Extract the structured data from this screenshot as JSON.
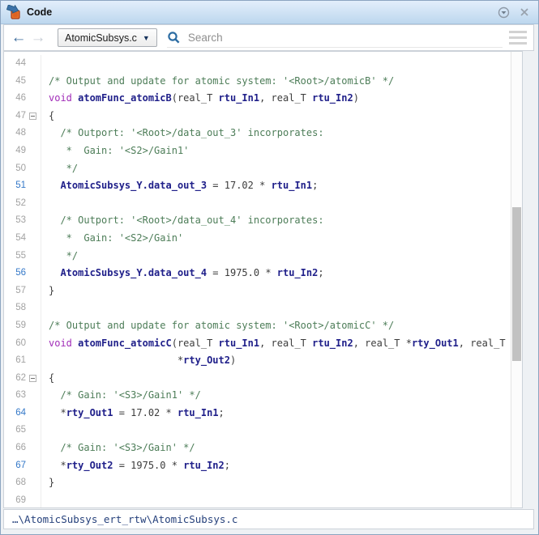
{
  "window": {
    "title": "Code"
  },
  "titlebar": {
    "app_icon": "simulink-code-badge-icon",
    "pin_icon": "dock-menu-icon",
    "close_icon": "close-icon"
  },
  "toolbar": {
    "back_arrow": "←",
    "forward_arrow": "→",
    "file_selector_value": "AtomicSubsys.c",
    "dropdown_caret": "▼",
    "search_placeholder": "Search",
    "search_value": "",
    "menu_icon": "hamburger-menu-icon"
  },
  "statusbar": {
    "path": "…\\AtomicSubsys_ert_rtw\\AtomicSubsys.c"
  },
  "colors": {
    "titlebar_blue": "#bdd7ee",
    "comment_green": "#4d7d58",
    "keyword_purple": "#a12db8",
    "symbol_navy": "#20208a",
    "line_link_blue": "#3478c8",
    "line_number_gray": "#a2a2a2",
    "icon_orange": "#e8742c",
    "icon_blue": "#3c72a8"
  },
  "editor": {
    "first_line": 44,
    "last_line": 69,
    "traceable_line_numbers": [
      51,
      56,
      64,
      67
    ],
    "folded_brace_lines": [
      47,
      62
    ],
    "lines": [
      {
        "n": 44,
        "link": false,
        "fold": false,
        "s": []
      },
      {
        "n": 45,
        "link": false,
        "fold": false,
        "s": [
          [
            "cm",
            "/* Output and update for atomic system: '<Root>/atomicB' */"
          ]
        ]
      },
      {
        "n": 46,
        "link": false,
        "fold": false,
        "s": [
          [
            "kw",
            "void "
          ],
          [
            "id",
            "atomFunc_atomicB"
          ],
          [
            "pl",
            "(real_T "
          ],
          [
            "id",
            "rtu_In1"
          ],
          [
            "pl",
            ", real_T "
          ],
          [
            "id",
            "rtu_In2"
          ],
          [
            "pl",
            ")"
          ]
        ]
      },
      {
        "n": 47,
        "link": false,
        "fold": true,
        "s": [
          [
            "pl",
            "{"
          ]
        ]
      },
      {
        "n": 48,
        "link": false,
        "fold": false,
        "s": [
          [
            "cm",
            "  /* Outport: '<Root>/data_out_3' incorporates:"
          ]
        ]
      },
      {
        "n": 49,
        "link": false,
        "fold": false,
        "s": [
          [
            "cm",
            "   *  Gain: '<S2>/Gain1'"
          ]
        ]
      },
      {
        "n": 50,
        "link": false,
        "fold": false,
        "s": [
          [
            "cm",
            "   */"
          ]
        ]
      },
      {
        "n": 51,
        "link": true,
        "fold": false,
        "s": [
          [
            "pl",
            "  "
          ],
          [
            "id",
            "AtomicSubsys_Y.data_out_3"
          ],
          [
            "pl",
            " = 17.02 * "
          ],
          [
            "id",
            "rtu_In1"
          ],
          [
            "pl",
            ";"
          ]
        ]
      },
      {
        "n": 52,
        "link": false,
        "fold": false,
        "s": []
      },
      {
        "n": 53,
        "link": false,
        "fold": false,
        "s": [
          [
            "cm",
            "  /* Outport: '<Root>/data_out_4' incorporates:"
          ]
        ]
      },
      {
        "n": 54,
        "link": false,
        "fold": false,
        "s": [
          [
            "cm",
            "   *  Gain: '<S2>/Gain'"
          ]
        ]
      },
      {
        "n": 55,
        "link": false,
        "fold": false,
        "s": [
          [
            "cm",
            "   */"
          ]
        ]
      },
      {
        "n": 56,
        "link": true,
        "fold": false,
        "s": [
          [
            "pl",
            "  "
          ],
          [
            "id",
            "AtomicSubsys_Y.data_out_4"
          ],
          [
            "pl",
            " = 1975.0 * "
          ],
          [
            "id",
            "rtu_In2"
          ],
          [
            "pl",
            ";"
          ]
        ]
      },
      {
        "n": 57,
        "link": false,
        "fold": false,
        "s": [
          [
            "pl",
            "}"
          ]
        ]
      },
      {
        "n": 58,
        "link": false,
        "fold": false,
        "s": []
      },
      {
        "n": 59,
        "link": false,
        "fold": false,
        "s": [
          [
            "cm",
            "/* Output and update for atomic system: '<Root>/atomicC' */"
          ]
        ]
      },
      {
        "n": 60,
        "link": false,
        "fold": false,
        "s": [
          [
            "kw",
            "void "
          ],
          [
            "id",
            "atomFunc_atomicC"
          ],
          [
            "pl",
            "(real_T "
          ],
          [
            "id",
            "rtu_In1"
          ],
          [
            "pl",
            ", real_T "
          ],
          [
            "id",
            "rtu_In2"
          ],
          [
            "pl",
            ", real_T *"
          ],
          [
            "id",
            "rty_Out1"
          ],
          [
            "pl",
            ", real_T"
          ]
        ]
      },
      {
        "n": 61,
        "link": false,
        "fold": false,
        "s": [
          [
            "pl",
            "                      *"
          ],
          [
            "id",
            "rty_Out2"
          ],
          [
            "pl",
            ")"
          ]
        ]
      },
      {
        "n": 62,
        "link": false,
        "fold": true,
        "s": [
          [
            "pl",
            "{"
          ]
        ]
      },
      {
        "n": 63,
        "link": false,
        "fold": false,
        "s": [
          [
            "cm",
            "  /* Gain: '<S3>/Gain1' */"
          ]
        ]
      },
      {
        "n": 64,
        "link": true,
        "fold": false,
        "s": [
          [
            "pl",
            "  *"
          ],
          [
            "id",
            "rty_Out1"
          ],
          [
            "pl",
            " = 17.02 * "
          ],
          [
            "id",
            "rtu_In1"
          ],
          [
            "pl",
            ";"
          ]
        ]
      },
      {
        "n": 65,
        "link": false,
        "fold": false,
        "s": []
      },
      {
        "n": 66,
        "link": false,
        "fold": false,
        "s": [
          [
            "cm",
            "  /* Gain: '<S3>/Gain' */"
          ]
        ]
      },
      {
        "n": 67,
        "link": true,
        "fold": false,
        "s": [
          [
            "pl",
            "  *"
          ],
          [
            "id",
            "rty_Out2"
          ],
          [
            "pl",
            " = 1975.0 * "
          ],
          [
            "id",
            "rtu_In2"
          ],
          [
            "pl",
            ";"
          ]
        ]
      },
      {
        "n": 68,
        "link": false,
        "fold": false,
        "s": [
          [
            "pl",
            "}"
          ]
        ]
      },
      {
        "n": 69,
        "link": false,
        "fold": false,
        "s": []
      }
    ]
  }
}
